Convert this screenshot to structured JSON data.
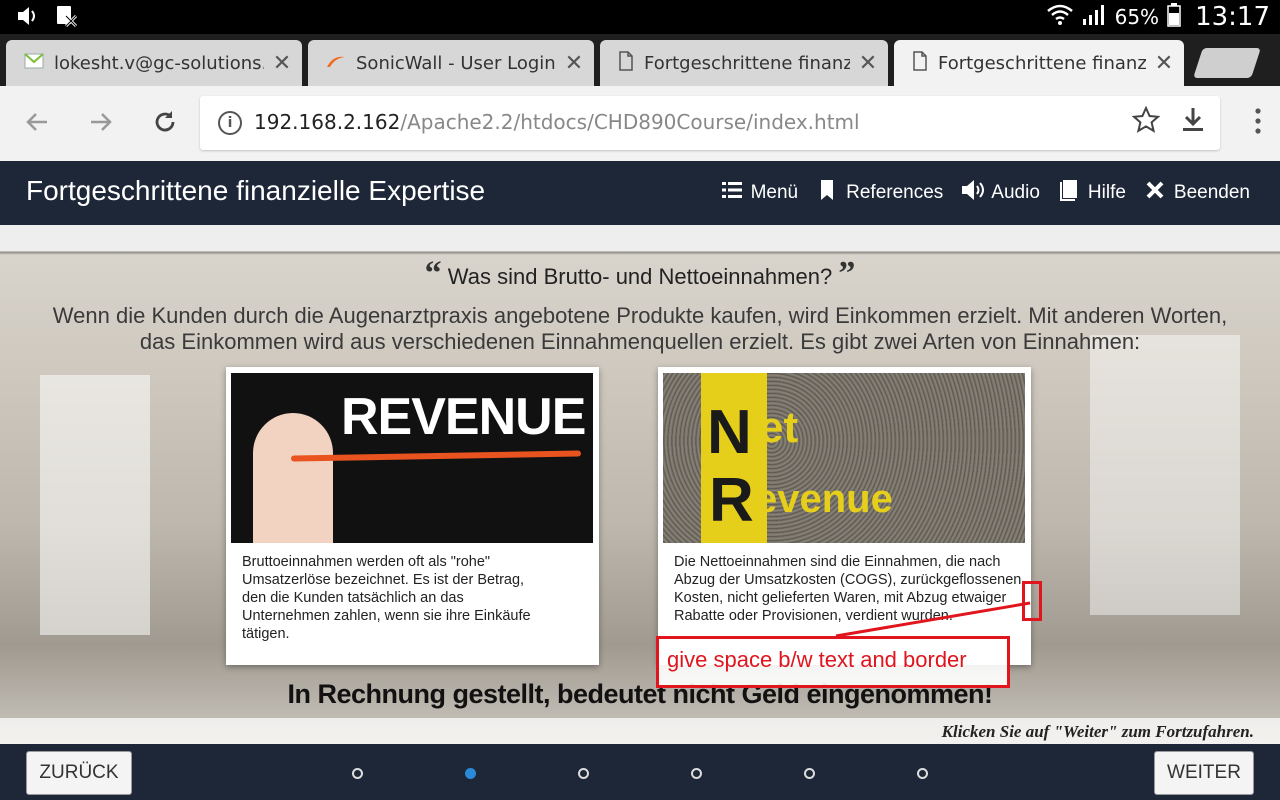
{
  "status_bar": {
    "left_icons": [
      "volume-icon",
      "no-sim-icon"
    ],
    "battery": "65%",
    "time": "13:17"
  },
  "tabs": [
    {
      "title": "lokesht.v@gc-solutions.",
      "icon": "mail-icon",
      "close": "✕"
    },
    {
      "title": "SonicWall - User Login S",
      "icon": "sonicwall-icon",
      "close": "✕"
    },
    {
      "title": "Fortgeschrittene finanzie",
      "icon": "page-icon",
      "close": "✕"
    },
    {
      "title": "Fortgeschrittene finanzie",
      "icon": "page-icon",
      "close": "✕"
    }
  ],
  "address_bar": {
    "host": "192.168.2.162",
    "path": "/Apache2.2/htdocs/CHD890Course/index.html"
  },
  "course": {
    "title": "Fortgeschrittene finanzielle Expertise",
    "nav": [
      {
        "label": "Menü",
        "icon": "list-icon"
      },
      {
        "label": "References",
        "icon": "bookmark-icon"
      },
      {
        "label": "Audio",
        "icon": "speaker-icon"
      },
      {
        "label": "Hilfe",
        "icon": "book-icon"
      },
      {
        "label": "Beenden",
        "icon": "close-icon"
      }
    ]
  },
  "content": {
    "question": "Was sind Brutto- und Nettoeinnahmen?",
    "quote_open": "“",
    "quote_close": "”",
    "intro": "Wenn die Kunden durch die Augenarztpraxis angebotene Produkte kaufen, wird Einkommen erzielt. Mit anderen Worten, das Einkommen wird aus verschiedenen Einnahmenquellen erzielt. Es gibt zwei Arten von Einnahmen:",
    "gross_card": {
      "image_text": "REVENUE",
      "text": "Bruttoeinnahmen werden oft als \"rohe\" Umsatzerlöse bezeichnet. Es ist der Betrag, den die Kunden tatsächlich an das Unternehmen zahlen, wenn sie ihre Einkäufe tätigen."
    },
    "net_card": {
      "image_N": "N",
      "image_et": "et",
      "image_R": "R",
      "image_evenue": "evenue",
      "text": "Die Nettoeinnahmen sind die Einnahmen, die nach Abzug der Umsatzkosten (COGS), zurückgeflossenen Kosten, nicht gelieferten Waren, mit Abzug etwaiger Rabatte oder Provisionen, verdient wurden."
    },
    "subheading": "In Rechnung gestellt, bedeutet nicht Geld eingenommen!",
    "continue_hint": "Klicken Sie auf \"Weiter\" zum Fortzufahren."
  },
  "annotation": {
    "text": "give space b/w text and border",
    "color": "#e0151d"
  },
  "footer": {
    "back_label": "ZURÜCK",
    "next_label": "WEITER",
    "page_count": 6,
    "current_page": 2
  },
  "colors": {
    "header_bg": "#1d2738",
    "accent_dot": "#2a8ad8"
  }
}
